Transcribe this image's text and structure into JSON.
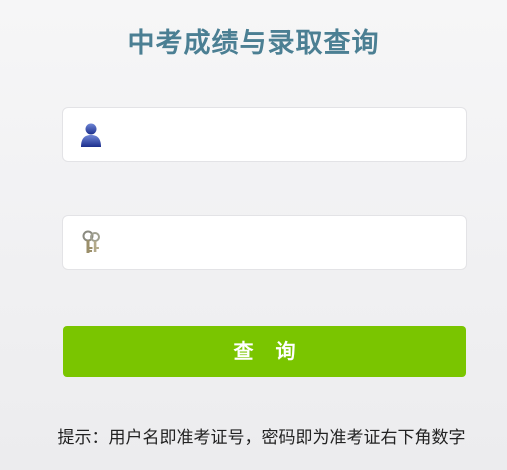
{
  "page": {
    "title": "中考成绩与录取查询"
  },
  "form": {
    "username": {
      "value": "",
      "placeholder": "",
      "icon": "user-icon"
    },
    "password": {
      "value": "",
      "placeholder": "",
      "icon": "keys-icon"
    },
    "submit_label": "查询"
  },
  "hint": {
    "text": "提示：用户名即准考证号，密码即为准考证右下角数字"
  },
  "colors": {
    "title": "#4b7f93",
    "button": "#7ac500",
    "button_text": "#ffffff"
  }
}
